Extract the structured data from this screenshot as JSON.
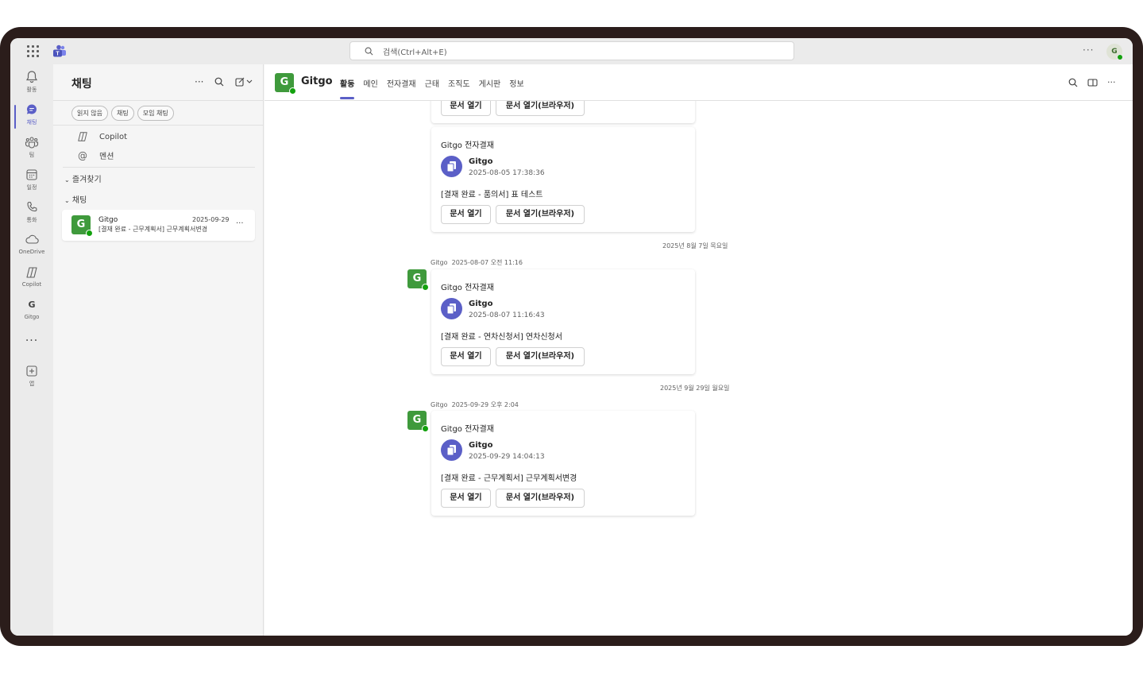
{
  "titlebar": {
    "search_placeholder": "검색(Ctrl+Alt+E)",
    "more": "···",
    "avatar_initial": "G"
  },
  "rail": {
    "items": [
      {
        "label": "활동",
        "icon": "bell-icon"
      },
      {
        "label": "채팅",
        "icon": "chat-icon"
      },
      {
        "label": "팀",
        "icon": "teams-icon"
      },
      {
        "label": "일정",
        "icon": "calendar-icon"
      },
      {
        "label": "통화",
        "icon": "phone-icon"
      },
      {
        "label": "OneDrive",
        "icon": "cloud-icon"
      },
      {
        "label": "Copilot",
        "icon": "copilot-icon"
      },
      {
        "label": "Gitgo",
        "icon": "gitgo-icon"
      },
      {
        "label": "앱",
        "icon": "add-app-icon"
      }
    ],
    "more": "···",
    "gitgo_glyph": "G"
  },
  "pane": {
    "title": "채팅",
    "more": "···",
    "filters": [
      "읽지 않음",
      "채팅",
      "모임 채팅"
    ],
    "shortcuts": [
      {
        "label": "Copilot",
        "icon": "copilot-icon"
      },
      {
        "label": "멘션",
        "icon": "at-icon",
        "glyph": "@"
      }
    ],
    "sections": [
      {
        "label": "즐겨찾기"
      },
      {
        "label": "채팅"
      }
    ],
    "chat": {
      "badge": "G",
      "name": "Gitgo",
      "date": "2025-09-29",
      "preview": "[결재 완료 - 근무계획서] 근무계획서변경",
      "more": "···"
    }
  },
  "main": {
    "badge": "G",
    "title": "Gitgo",
    "tabs": [
      "활동",
      "메인",
      "전자결재",
      "근태",
      "조직도",
      "게시판",
      "정보"
    ],
    "active_tab": 0,
    "more": "···",
    "partial_buttons": {
      "open": "문서 열기",
      "open_browser": "문서 열기(브라우저)"
    },
    "messages": [
      {
        "card_title": "Gitgo 전자결재",
        "sender": "Gitgo",
        "time": "2025-08-05 17:38:36",
        "body": "[결재 완료 - 품의서] 표 테스트",
        "btn_open": "문서 열기",
        "btn_open_browser": "문서 열기(브라우저)"
      },
      {
        "day": "2025년 8월 7일 목요일",
        "meta_sender": "Gitgo",
        "meta_time": "2025-08-07 오전 11:16",
        "badge": "G",
        "card_title": "Gitgo 전자결재",
        "sender": "Gitgo",
        "time": "2025-08-07 11:16:43",
        "body": "[결재 완료 - 연차신청서] 연차신청서",
        "btn_open": "문서 열기",
        "btn_open_browser": "문서 열기(브라우저)"
      },
      {
        "day": "2025년 9월 29일 월요일",
        "meta_sender": "Gitgo",
        "meta_time": "2025-09-29 오후 2:04",
        "badge": "G",
        "card_title": "Gitgo 전자결재",
        "sender": "Gitgo",
        "time": "2025-09-29 14:04:13",
        "body": "[결재 완료 - 근무계획서] 근무계획서변경",
        "btn_open": "문서 열기",
        "btn_open_browser": "문서 열기(브라우저)"
      }
    ]
  },
  "colors": {
    "accent": "#5b5fc7",
    "gitgo_green": "#3f9a3c",
    "presence": "#13a10e",
    "frame": "#2b1d1b"
  }
}
